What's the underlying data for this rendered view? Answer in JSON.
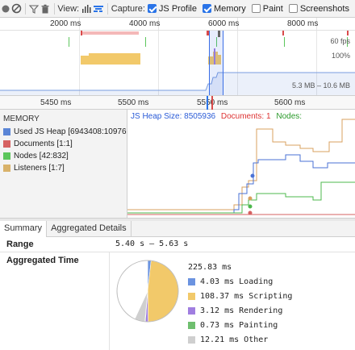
{
  "toolbar": {
    "view_label": "View:",
    "capture_label": "Capture:",
    "options": [
      {
        "label": "JS Profile",
        "checked": true
      },
      {
        "label": "Memory",
        "checked": true
      },
      {
        "label": "Paint",
        "checked": false
      },
      {
        "label": "Screenshots",
        "checked": false
      }
    ]
  },
  "overview": {
    "ticks": [
      "2000 ms",
      "4000 ms",
      "6000 ms",
      "8000 ms"
    ],
    "fps_label": "60 fps",
    "cpu_label": "100%",
    "heap_range": "5.3 MB – 10.6 MB"
  },
  "ruler": {
    "ticks": [
      "5450 ms",
      "5500 ms",
      "5550 ms",
      "5600 ms"
    ]
  },
  "memory": {
    "title": "MEMORY",
    "legend": [
      {
        "label": "Used JS Heap [6943408:10976",
        "color": "#5a85d6"
      },
      {
        "label": "Documents [1:1]",
        "color": "#d66161"
      },
      {
        "label": "Nodes [42:832]",
        "color": "#5cc65c"
      },
      {
        "label": "Listeners [1:7]",
        "color": "#d9b26a"
      }
    ],
    "header": {
      "heap": "JS Heap Size: 8505936",
      "documents": "Documents: 1",
      "nodes": "Nodes:"
    }
  },
  "tabs": [
    {
      "label": "Summary",
      "active": true
    },
    {
      "label": "Aggregated Details",
      "active": false
    }
  ],
  "summary": {
    "range_label": "Range",
    "range_value": "5.40 s – 5.63 s",
    "agg_label": "Aggregated Time",
    "total": "225.83 ms",
    "items": [
      {
        "label": "4.03 ms Loading",
        "color": "#6b93e0",
        "ms": 4.03
      },
      {
        "label": "108.37 ms Scripting",
        "color": "#f2c96a",
        "ms": 108.37
      },
      {
        "label": "3.12 ms Rendering",
        "color": "#a07ee0",
        "ms": 3.12
      },
      {
        "label": "0.73 ms Painting",
        "color": "#6fbf6f",
        "ms": 0.73
      },
      {
        "label": "12.21 ms Other",
        "color": "#cfcfcf",
        "ms": 12.21
      }
    ],
    "idle_ms": 97.37
  }
}
